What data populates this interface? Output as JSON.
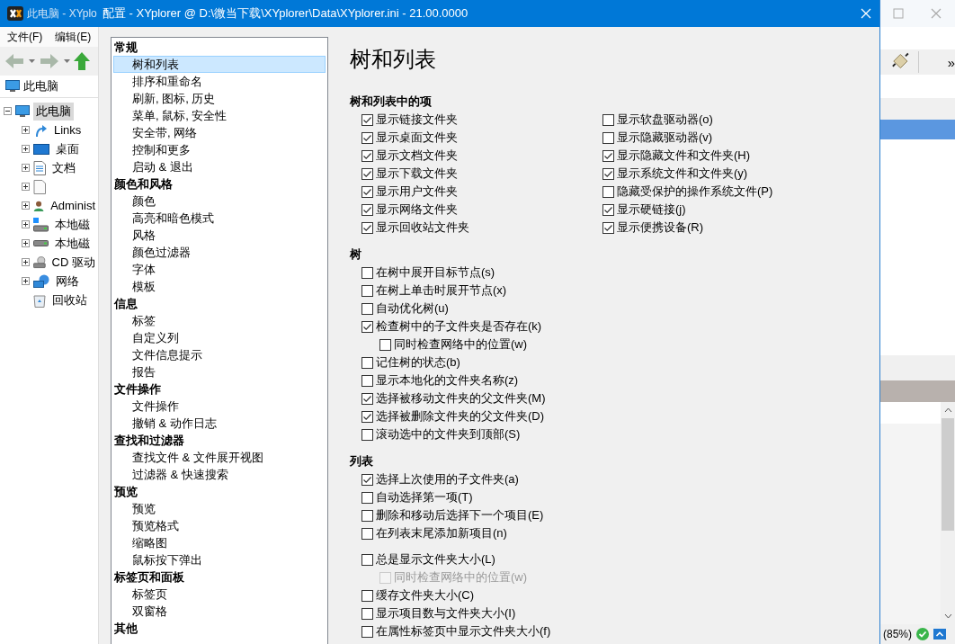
{
  "app_window": {
    "title": "此电脑 - XYplo",
    "menu": [
      "文件(F)",
      "编辑(E)"
    ],
    "address": "此电脑",
    "tree": [
      {
        "label": "此电脑",
        "kind": "computer",
        "selected": true,
        "expanded": true,
        "children": [
          {
            "label": "Links",
            "kind": "link",
            "selected": false,
            "expanded": false
          },
          {
            "label": "桌面",
            "kind": "desktop",
            "selected": false,
            "expanded": false
          },
          {
            "label": "文档",
            "kind": "document",
            "selected": false,
            "expanded": false
          },
          {
            "kind": "file",
            "selected": false,
            "expanded": false
          },
          {
            "label": "Administ",
            "kind": "user",
            "selected": false,
            "expanded": false
          },
          {
            "label": "本地磁",
            "kind": "drive-windows",
            "selected": false,
            "expanded": false
          },
          {
            "label": "本地磁",
            "kind": "drive",
            "selected": false,
            "expanded": false
          },
          {
            "label": "CD 驱动",
            "kind": "cd",
            "selected": false,
            "expanded": false
          },
          {
            "label": "网络",
            "kind": "network",
            "selected": false,
            "expanded": false
          },
          {
            "label": "回收站",
            "kind": "recycle",
            "selected": false
          }
        ]
      }
    ],
    "overflow_button": "»",
    "status_zoom": "(85%)"
  },
  "dialog": {
    "title": "配置 - XYplorer @ D:\\微当下载\\XYplorer\\Data\\XYplorer.ini - 21.00.0000",
    "nav": [
      {
        "label": "常规",
        "items": [
          {
            "label": "树和列表",
            "selected": true
          },
          {
            "label": "排序和重命名",
            "selected": false
          },
          {
            "label": "刷新, 图标, 历史",
            "selected": false
          },
          {
            "label": "菜单, 鼠标, 安全性",
            "selected": false
          },
          {
            "label": "安全带, 网络",
            "selected": false
          },
          {
            "label": "控制和更多",
            "selected": false
          },
          {
            "label": "启动 & 退出",
            "selected": false
          }
        ]
      },
      {
        "label": "颜色和风格",
        "items": [
          {
            "label": "颜色",
            "selected": false
          },
          {
            "label": "高亮和暗色模式",
            "selected": false
          },
          {
            "label": "风格",
            "selected": false
          },
          {
            "label": "颜色过滤器",
            "selected": false
          },
          {
            "label": "字体",
            "selected": false
          },
          {
            "label": "模板",
            "selected": false
          }
        ]
      },
      {
        "label": "信息",
        "items": [
          {
            "label": "标签",
            "selected": false
          },
          {
            "label": "自定义列",
            "selected": false
          },
          {
            "label": "文件信息提示",
            "selected": false
          },
          {
            "label": "报告",
            "selected": false
          }
        ]
      },
      {
        "label": "文件操作",
        "items": [
          {
            "label": "文件操作",
            "selected": false
          },
          {
            "label": "撤销 & 动作日志",
            "selected": false
          }
        ]
      },
      {
        "label": "查找和过滤器",
        "items": [
          {
            "label": "查找文件 & 文件展开视图",
            "selected": false
          },
          {
            "label": "过滤器 & 快速搜索",
            "selected": false
          }
        ]
      },
      {
        "label": "预览",
        "items": [
          {
            "label": "预览",
            "selected": false
          },
          {
            "label": "预览格式",
            "selected": false
          },
          {
            "label": "缩略图",
            "selected": false
          },
          {
            "label": "鼠标按下弹出",
            "selected": false
          }
        ]
      },
      {
        "label": "标签页和面板",
        "items": [
          {
            "label": "标签页",
            "selected": false
          },
          {
            "label": "双窗格",
            "selected": false
          }
        ]
      },
      {
        "label": "其他"
      }
    ],
    "page_title": "树和列表",
    "sections": [
      {
        "title": "树和列表中的项",
        "columns": [
          [
            [
              {
                "label": "显示链接文件夹",
                "checked": true,
                "disabled": false
              },
              {
                "label": "显示桌面文件夹",
                "checked": true,
                "disabled": false
              },
              {
                "label": "显示文档文件夹",
                "checked": true,
                "disabled": false
              },
              {
                "label": "显示下载文件夹",
                "checked": true,
                "disabled": false
              },
              {
                "label": "显示用户文件夹",
                "checked": true,
                "disabled": false
              },
              {
                "label": "显示网络文件夹",
                "checked": true,
                "disabled": false
              },
              {
                "label": "显示回收站文件夹",
                "checked": true,
                "disabled": false
              }
            ]
          ],
          [
            [
              {
                "label": "显示软盘驱动器(o)",
                "checked": false,
                "disabled": false
              },
              {
                "label": "显示隐藏驱动器(v)",
                "checked": false,
                "disabled": false
              },
              {
                "label": "显示隐藏文件和文件夹(H)",
                "checked": true,
                "disabled": false
              },
              {
                "label": "显示系统文件和文件夹(y)",
                "checked": true,
                "disabled": false
              },
              {
                "label": "隐藏受保护的操作系统文件(P)",
                "checked": false,
                "disabled": false
              },
              {
                "label": "显示硬链接(j)",
                "checked": true,
                "disabled": false
              },
              {
                "label": "显示便携设备(R)",
                "checked": true,
                "disabled": false
              }
            ]
          ]
        ]
      },
      {
        "title": "树",
        "columns": [
          [
            [
              {
                "label": "在树中展开目标节点(s)",
                "checked": false,
                "disabled": false
              },
              {
                "label": "在树上单击时展开节点(x)",
                "checked": false,
                "disabled": false
              },
              {
                "label": "自动优化树(u)",
                "checked": false,
                "disabled": false
              },
              {
                "label": "检查树中的子文件夹是否存在(k)",
                "checked": true,
                "disabled": false,
                "children": [
                  {
                    "label": "同时检查网络中的位置(w)",
                    "checked": false,
                    "disabled": false
                  }
                ]
              },
              {
                "label": "记住树的状态(b)",
                "checked": false,
                "disabled": false
              },
              {
                "label": "显示本地化的文件夹名称(z)",
                "checked": false,
                "disabled": false
              },
              {
                "label": "选择被移动文件夹的父文件夹(M)",
                "checked": true,
                "disabled": false
              },
              {
                "label": "选择被删除文件夹的父文件夹(D)",
                "checked": true,
                "disabled": false
              },
              {
                "label": "滚动选中的文件夹到顶部(S)",
                "checked": false,
                "disabled": false
              }
            ]
          ]
        ]
      },
      {
        "title": "列表",
        "columns": [
          [
            [
              {
                "label": "选择上次使用的子文件夹(a)",
                "checked": true,
                "disabled": false
              },
              {
                "label": "自动选择第一项(T)",
                "checked": false,
                "disabled": false
              },
              {
                "label": "删除和移动后选择下一个项目(E)",
                "checked": false,
                "disabled": false
              },
              {
                "label": "在列表末尾添加新项目(n)",
                "checked": false,
                "disabled": false
              }
            ],
            [
              {
                "label": "总是显示文件夹大小(L)",
                "checked": false,
                "disabled": false,
                "children": [
                  {
                    "label": "同时检查网络中的位置(w)",
                    "checked": false,
                    "disabled": true
                  }
                ]
              },
              {
                "label": "缓存文件夹大小(C)",
                "checked": false,
                "disabled": false
              },
              {
                "label": "显示项目数与文件夹大小(I)",
                "checked": false,
                "disabled": false
              },
              {
                "label": "在属性标签页中显示文件夹大小(f)",
                "checked": false,
                "disabled": false
              }
            ]
          ]
        ]
      }
    ]
  }
}
